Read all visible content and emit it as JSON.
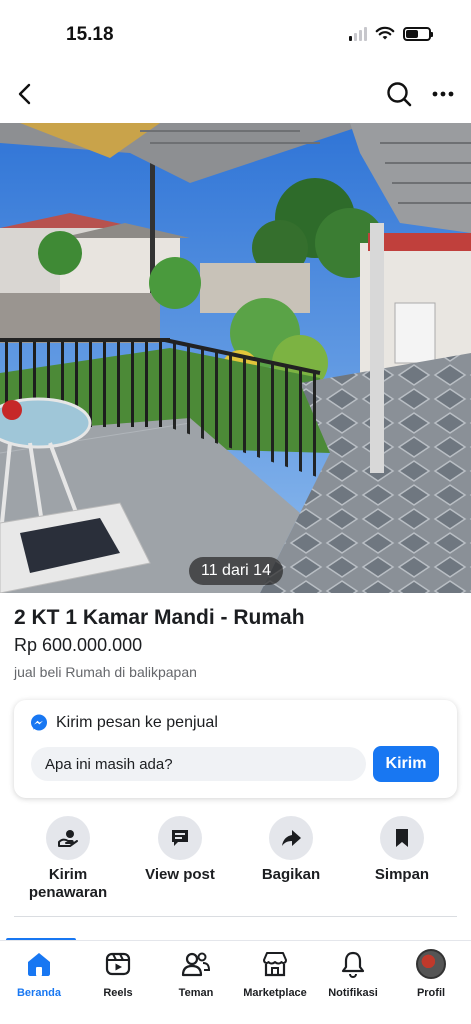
{
  "status_bar": {
    "time": "15.18",
    "signal_bars_on": 1,
    "battery_level": 0.55
  },
  "nav": {
    "back_icon": "chevron-left-icon",
    "search_icon": "search-icon",
    "more_icon": "more-horizontal-icon"
  },
  "photo": {
    "counter": "11 dari 14"
  },
  "listing": {
    "title": "2 KT 1 Kamar Mandi - Rumah",
    "price": "Rp 600.000.000",
    "category": "jual beli Rumah di balikpapan"
  },
  "message_card": {
    "header": "Kirim pesan ke penjual",
    "input_value": "Apa ini masih ada?",
    "send_label": "Kirim"
  },
  "actions": [
    {
      "label": "Kirim\npenawaran",
      "icon": "offer-hand-icon"
    },
    {
      "label": "View post",
      "icon": "post-icon"
    },
    {
      "label": "Bagikan",
      "icon": "share-arrow-icon"
    },
    {
      "label": "Simpan",
      "icon": "bookmark-icon"
    }
  ],
  "bottom_nav": [
    {
      "label": "Beranda",
      "icon": "home-icon",
      "active": true
    },
    {
      "label": "Reels",
      "icon": "reels-icon",
      "active": false
    },
    {
      "label": "Teman",
      "icon": "friends-icon",
      "active": false
    },
    {
      "label": "Marketplace",
      "icon": "marketplace-icon",
      "active": false
    },
    {
      "label": "Notifikasi",
      "icon": "bell-icon",
      "active": false
    },
    {
      "label": "Profil",
      "icon": "avatar",
      "active": false
    }
  ],
  "colors": {
    "accent": "#1877f2",
    "text": "#1c1e21",
    "muted": "#65676b"
  }
}
